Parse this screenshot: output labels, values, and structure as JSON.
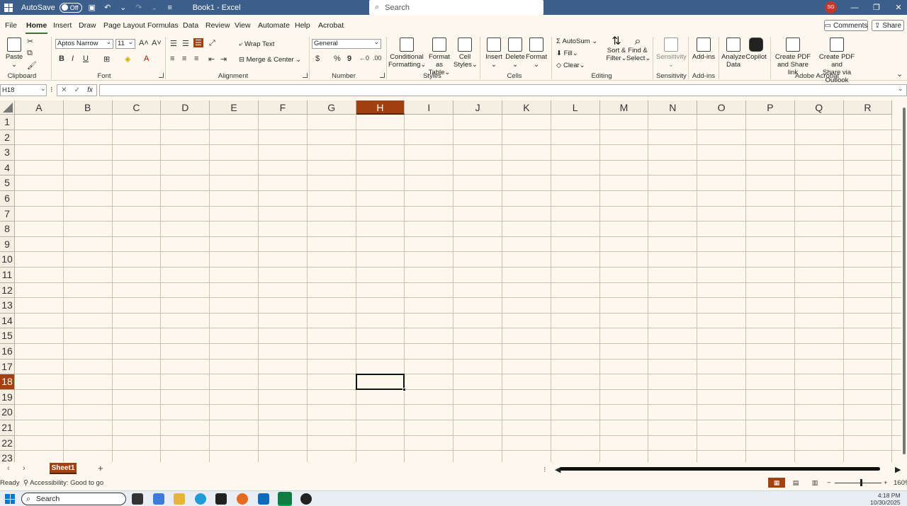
{
  "titlebar": {
    "autosave_label": "AutoSave",
    "autosave_state": "Off",
    "doc_title": "Book1 - Excel",
    "search_placeholder": "Search",
    "user_initials": "SG"
  },
  "menu": {
    "tabs": [
      "File",
      "Home",
      "Insert",
      "Draw",
      "Page Layout",
      "Formulas",
      "Data",
      "Review",
      "View",
      "Automate",
      "Help",
      "Acrobat"
    ],
    "active": "Home",
    "comments_label": "Comments",
    "share_label": "Share"
  },
  "ribbon": {
    "clipboard": {
      "paste": "Paste",
      "group": "Clipboard"
    },
    "font": {
      "name": "Aptos Narrow",
      "size": "11",
      "group": "Font",
      "bold": "B",
      "italic": "I",
      "underline": "U"
    },
    "alignment": {
      "wrap_text": "Wrap Text",
      "merge_center": "Merge & Center",
      "group": "Alignment"
    },
    "number": {
      "format": "General",
      "currency": "$",
      "percent": "%",
      "comma": "9",
      "group": "Number"
    },
    "styles": {
      "conditional_1": "Conditional",
      "conditional_2": "Formatting",
      "format_table_1": "Format as",
      "format_table_2": "Table",
      "cell_styles_1": "Cell",
      "cell_styles_2": "Styles",
      "group": "Styles"
    },
    "cells": {
      "insert": "Insert",
      "delete": "Delete",
      "format": "Format",
      "group": "Cells"
    },
    "editing": {
      "autosum": "AutoSum",
      "fill": "Fill",
      "clear": "Clear",
      "sort_1": "Sort &",
      "sort_2": "Filter",
      "find_1": "Find &",
      "find_2": "Select",
      "group": "Editing"
    },
    "sensitivity": {
      "label": "Sensitivity",
      "group": "Sensitivity"
    },
    "addins": {
      "label": "Add-ins",
      "group": "Add-ins"
    },
    "analyze": {
      "line1": "Analyze",
      "line2": "Data"
    },
    "copilot": {
      "label": "Copilot"
    },
    "acrobat": {
      "pdf_link_1": "Create PDF",
      "pdf_link_2": "and Share link",
      "pdf_outlook_1": "Create PDF and",
      "pdf_outlook_2": "Share via Outlook",
      "group": "Adobe Acrobat"
    }
  },
  "formula_bar": {
    "name_box": "H18",
    "fx": "fx",
    "value": ""
  },
  "grid": {
    "columns": [
      "A",
      "B",
      "C",
      "D",
      "E",
      "F",
      "G",
      "H",
      "I",
      "J",
      "K",
      "L",
      "M",
      "N",
      "O",
      "P",
      "Q",
      "R"
    ],
    "rows": [
      "1",
      "2",
      "3",
      "4",
      "5",
      "6",
      "7",
      "8",
      "9",
      "10",
      "11",
      "12",
      "13",
      "14",
      "15",
      "16",
      "17",
      "18",
      "19",
      "20",
      "21",
      "22",
      "23"
    ],
    "selected_column": "H",
    "selected_row": "18"
  },
  "sheets": {
    "tabs": [
      "Sheet1"
    ],
    "active": "Sheet1",
    "add": "+"
  },
  "status": {
    "ready": "Ready",
    "accessibility": "Accessibility: Good to go",
    "zoom": "160%"
  },
  "taskbar": {
    "search": "Search",
    "time": "4:18 PM",
    "date": "10/30/2025"
  },
  "colors": {
    "titlebar": "#3b5f8a",
    "accent": "#a0410f",
    "sheet_bg": "#fdf8ee"
  }
}
